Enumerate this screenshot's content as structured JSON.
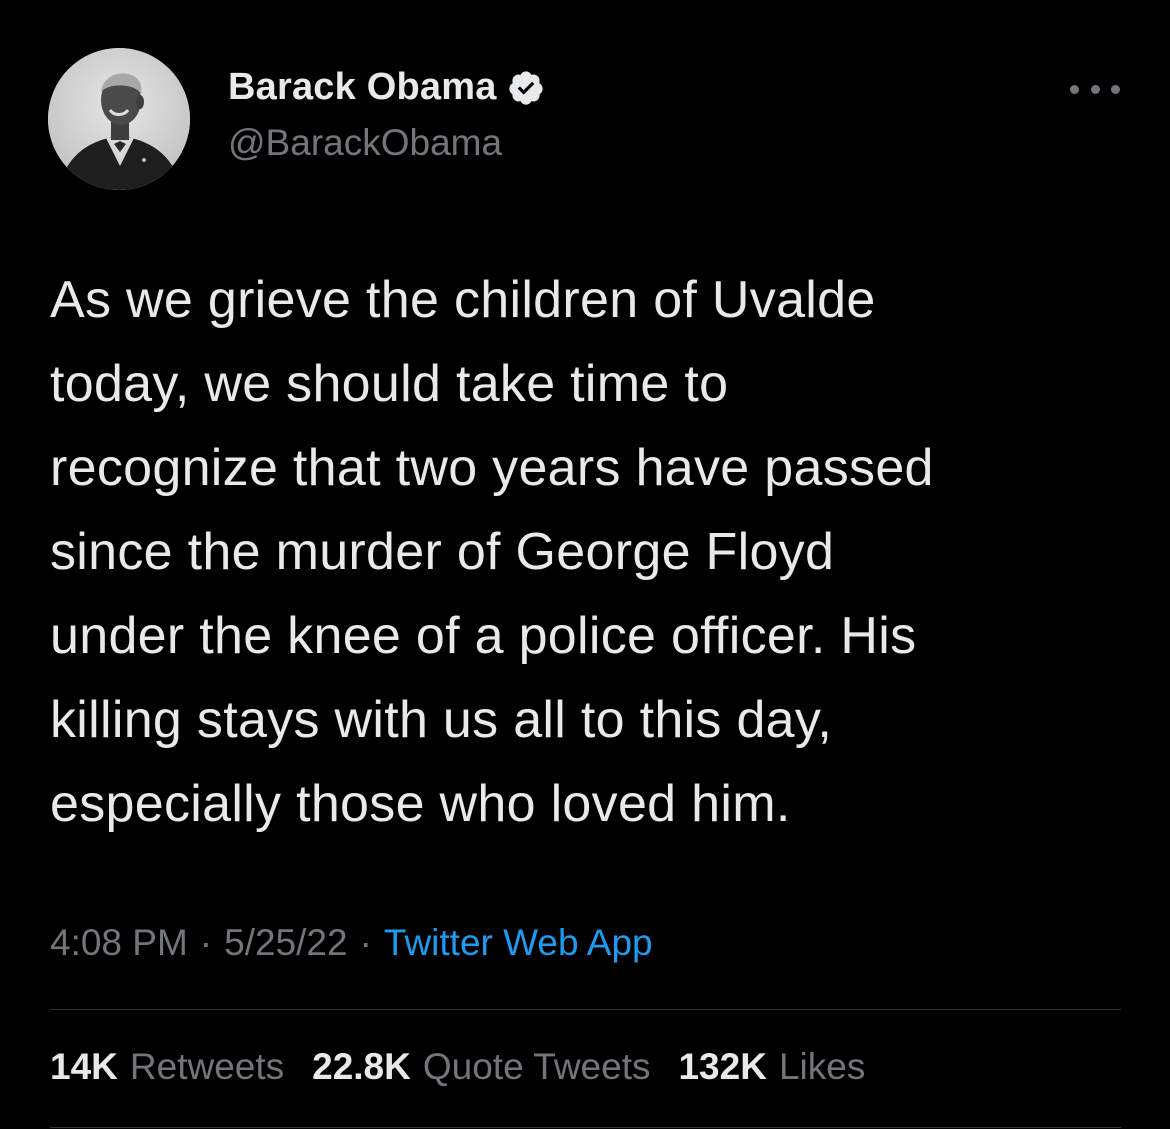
{
  "author": {
    "name": "Barack Obama",
    "handle": "@BarackObama",
    "verified": true,
    "avatar_icon": "profile-photo"
  },
  "tweet": {
    "text": "As we grieve the children of Uvalde\ntoday, we should take time to\nrecognize that two years have passed\nsince the murder of George Floyd\nunder the knee of a police officer. His\nkilling stays with us all to this day,\nespecially those who loved him.",
    "time": "4:08 PM",
    "date": "5/25/22",
    "source": "Twitter Web App",
    "separator": "·"
  },
  "stats": {
    "retweets_count": "14K",
    "retweets_label": "Retweets",
    "quotes_count": "22.8K",
    "quotes_label": "Quote Tweets",
    "likes_count": "132K",
    "likes_label": "Likes"
  },
  "colors": {
    "background": "#000000",
    "text_primary": "#e7e9ea",
    "text_secondary": "#71767b",
    "link": "#1d9bf0",
    "divider": "#2f3336"
  }
}
